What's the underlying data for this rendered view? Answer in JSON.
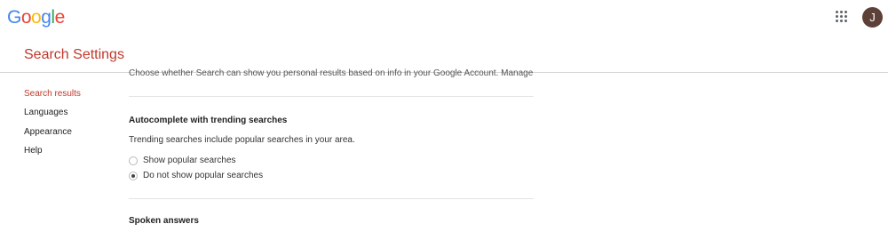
{
  "header": {
    "logo_letters": [
      {
        "char": "G",
        "color": "#4285F4"
      },
      {
        "char": "o",
        "color": "#EA4335"
      },
      {
        "char": "o",
        "color": "#FBBC05"
      },
      {
        "char": "g",
        "color": "#4285F4"
      },
      {
        "char": "l",
        "color": "#34A853"
      },
      {
        "char": "e",
        "color": "#EA4335"
      }
    ],
    "apps_icon": "grid-9-dots-icon",
    "avatar_initial": "J",
    "avatar_color": "#5d4037"
  },
  "page": {
    "title": "Search Settings",
    "accent_color": "#c0392b"
  },
  "sidebar": {
    "items": [
      {
        "label": "Search results",
        "active": true
      },
      {
        "label": "Languages",
        "active": false
      },
      {
        "label": "Appearance",
        "active": false
      },
      {
        "label": "Help",
        "active": false
      }
    ]
  },
  "main": {
    "personal_results": {
      "text": "Choose whether Search can show you personal results based on info in your Google Account.",
      "link": "Manage"
    },
    "autocomplete": {
      "title": "Autocomplete with trending searches",
      "description": "Trending searches include popular searches in your area.",
      "options": [
        {
          "label": "Show popular searches",
          "checked": false
        },
        {
          "label": "Do not show popular searches",
          "checked": true
        }
      ]
    },
    "spoken_answers": {
      "title": "Spoken answers"
    }
  }
}
